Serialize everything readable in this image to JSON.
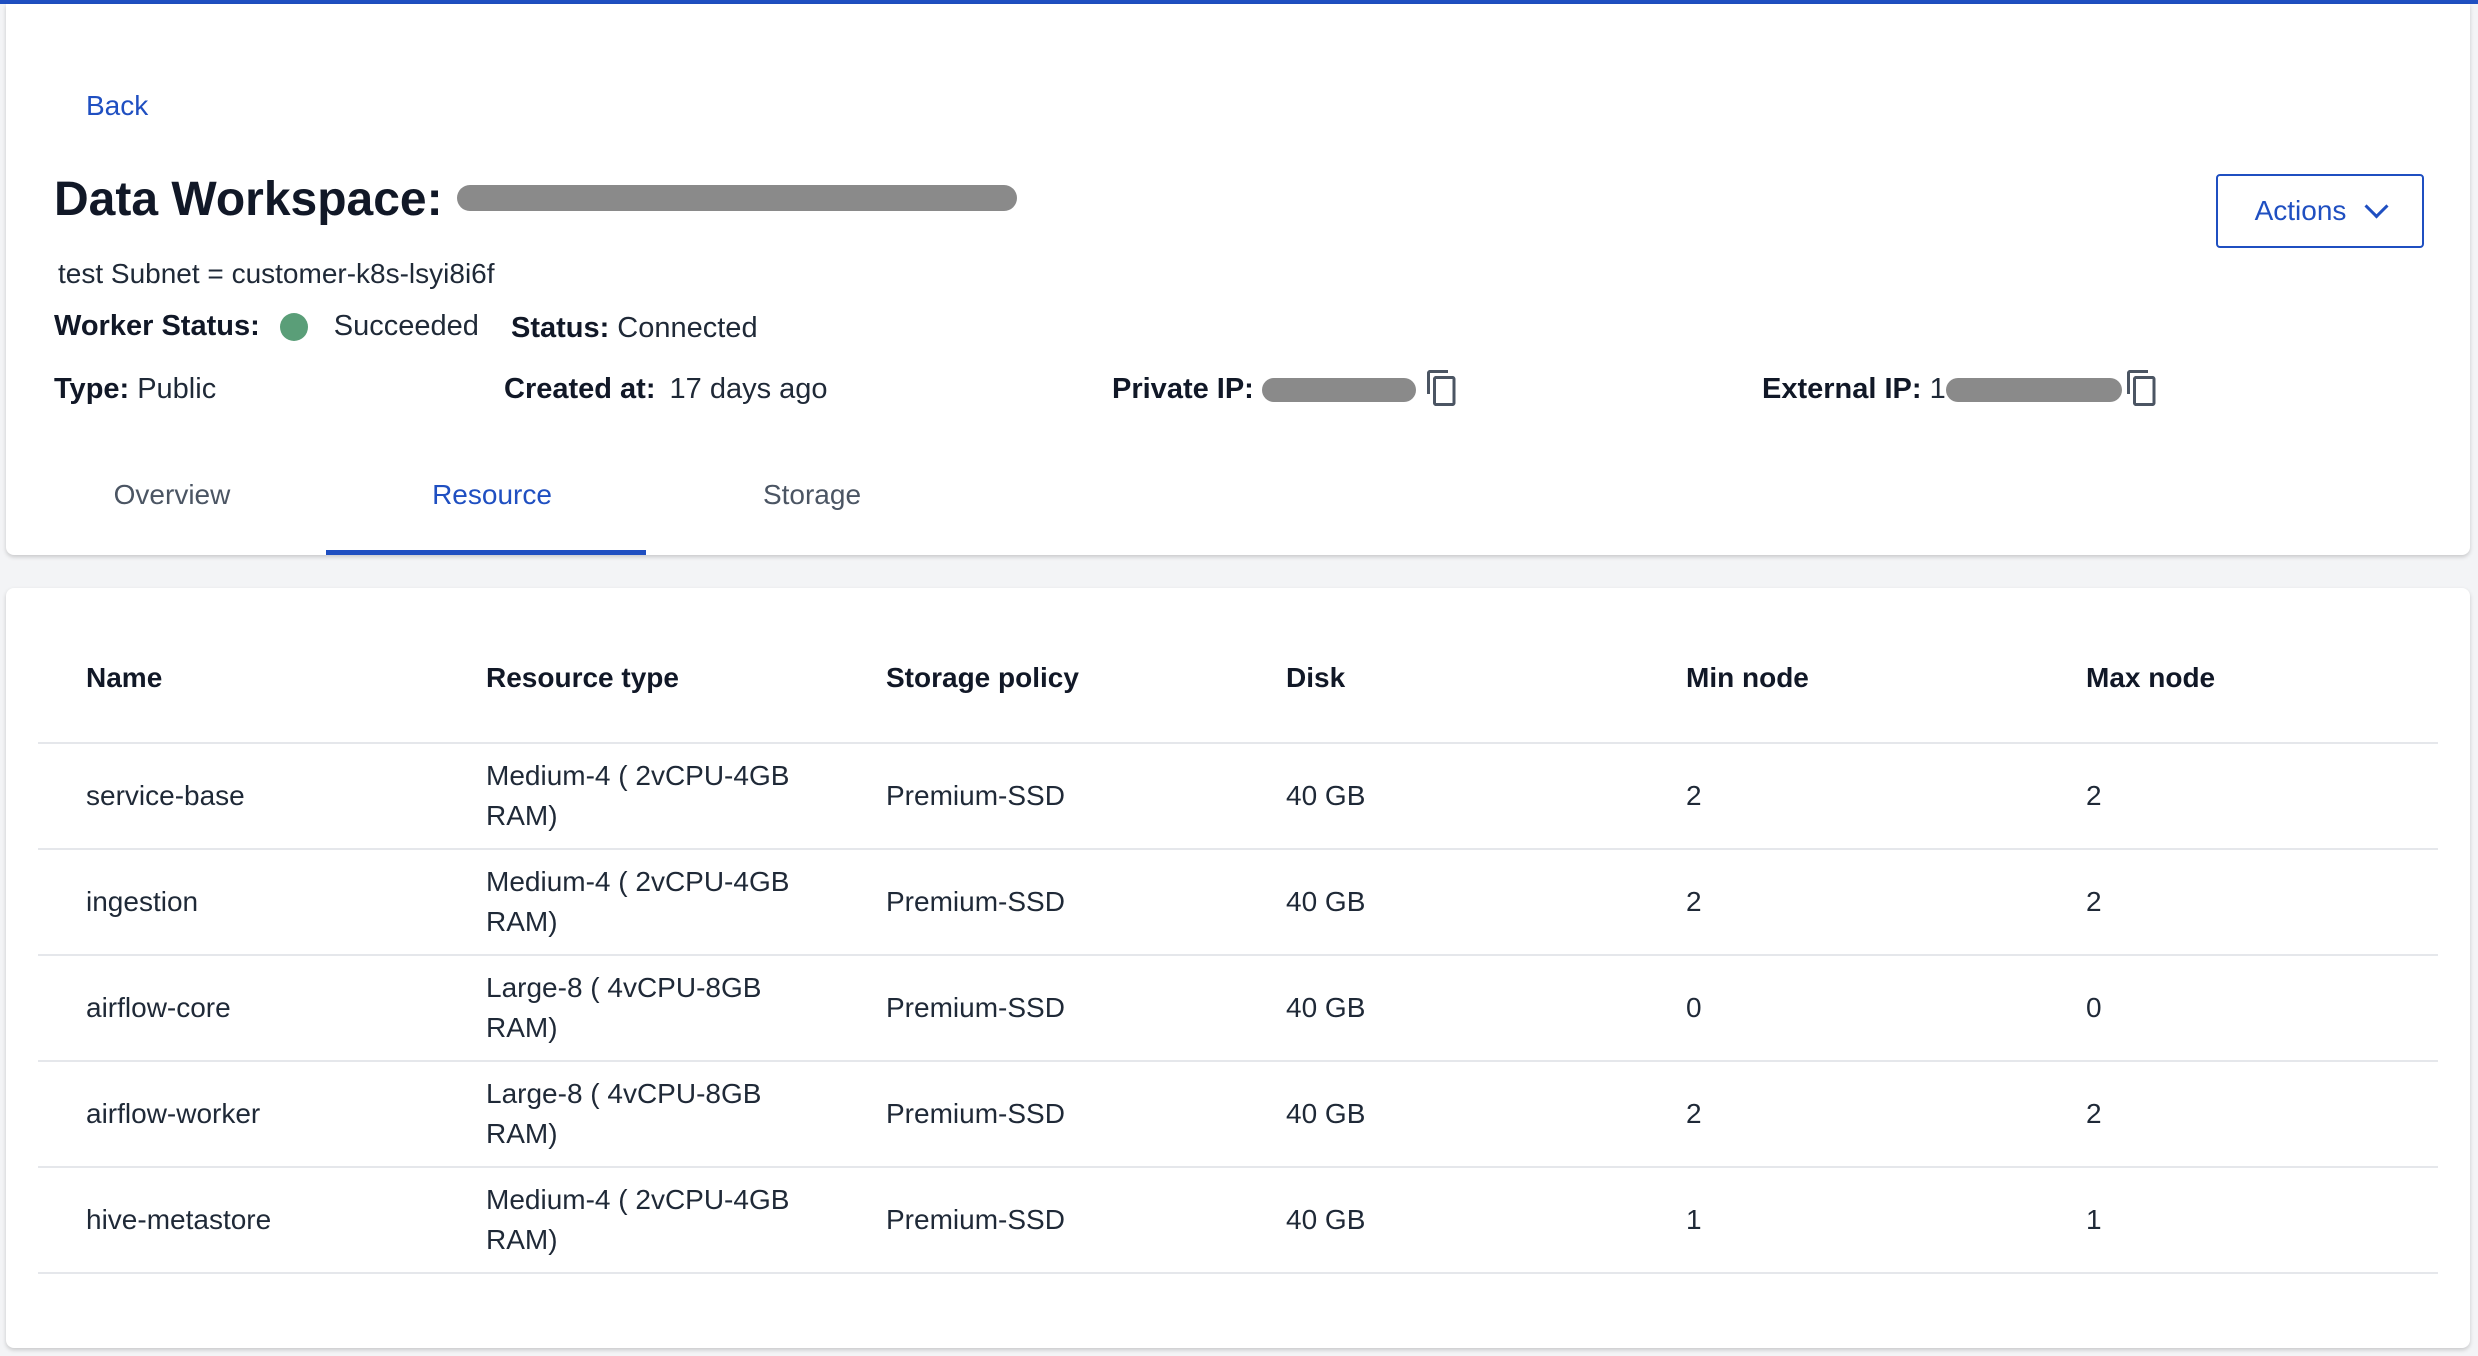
{
  "nav": {
    "back_label": "Back"
  },
  "workspace": {
    "title_prefix": "Data Workspace:",
    "subtitle": "test Subnet = customer-k8s-lsyi8i6f",
    "worker_status_label": "Worker Status:",
    "worker_status_value": "Succeeded",
    "status_label": "Status:",
    "status_value": "Connected",
    "type_label": "Type:",
    "type_value": "Public",
    "created_label": "Created at:",
    "created_value": "17 days ago",
    "private_ip_label": "Private IP:",
    "external_ip_label": "External IP:",
    "external_ip_visible_prefix": "1"
  },
  "actions": {
    "label": "Actions"
  },
  "tabs": [
    {
      "label": "Overview",
      "active": false
    },
    {
      "label": "Resource",
      "active": true
    },
    {
      "label": "Storage",
      "active": false
    }
  ],
  "table": {
    "headers": [
      "Name",
      "Resource type",
      "Storage policy",
      "Disk",
      "Min node",
      "Max node"
    ],
    "rows": [
      {
        "name": "service-base",
        "resource_type": "Medium-4 ( 2vCPU-4GB RAM)",
        "storage_policy": "Premium-SSD",
        "disk": "40 GB",
        "min_node": "2",
        "max_node": "2"
      },
      {
        "name": "ingestion",
        "resource_type": "Medium-4 ( 2vCPU-4GB RAM)",
        "storage_policy": "Premium-SSD",
        "disk": "40 GB",
        "min_node": "2",
        "max_node": "2"
      },
      {
        "name": "airflow-core",
        "resource_type": "Large-8 ( 4vCPU-8GB RAM)",
        "storage_policy": "Premium-SSD",
        "disk": "40 GB",
        "min_node": "0",
        "max_node": "0"
      },
      {
        "name": "airflow-worker",
        "resource_type": "Large-8 ( 4vCPU-8GB RAM)",
        "storage_policy": "Premium-SSD",
        "disk": "40 GB",
        "min_node": "2",
        "max_node": "2"
      },
      {
        "name": "hive-metastore",
        "resource_type": "Medium-4 ( 2vCPU-4GB RAM)",
        "storage_policy": "Premium-SSD",
        "disk": "40 GB",
        "min_node": "1",
        "max_node": "1"
      }
    ]
  },
  "colors": {
    "accent": "#1f4fc1",
    "status_success": "#5a9e78",
    "redaction": "#8a8a8a"
  },
  "icons": {
    "copy": "copy-icon",
    "actions_chevron": "chevron-down-icon",
    "status": "status-dot"
  }
}
